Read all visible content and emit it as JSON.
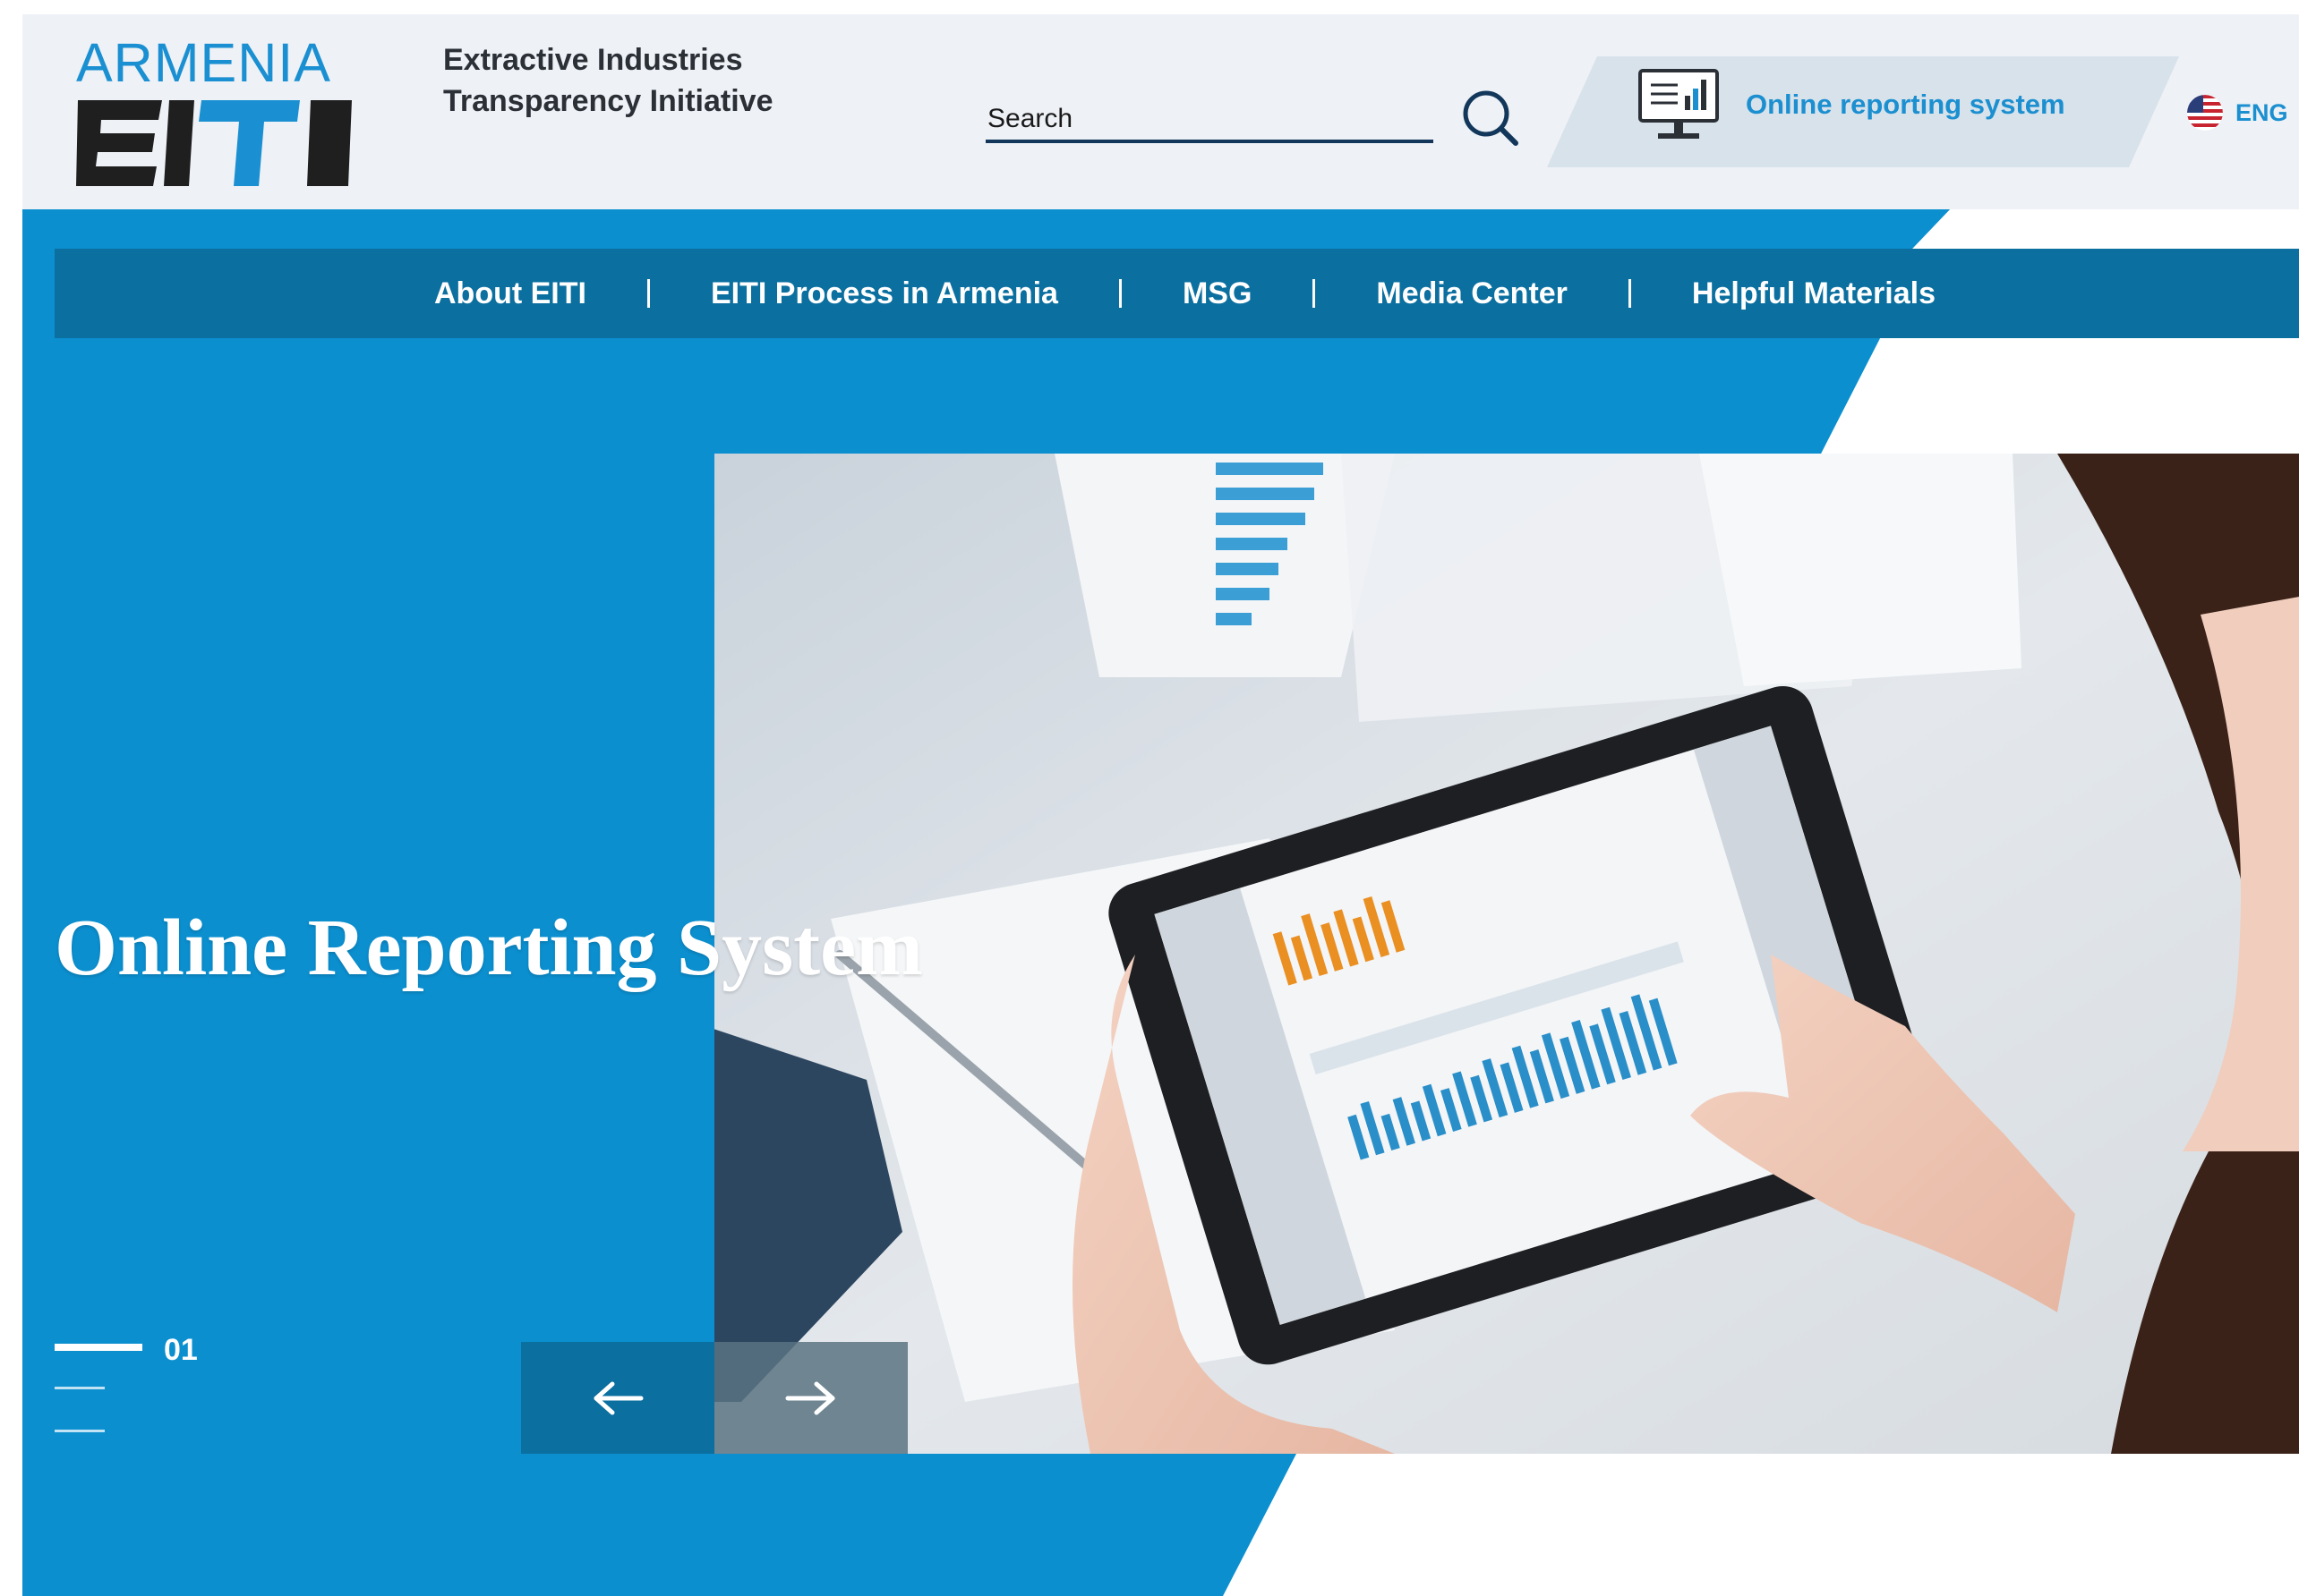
{
  "header": {
    "logo_top": "ARMENIA",
    "logo_bottom": "EITI",
    "tagline_line1": "Extractive Industries",
    "tagline_line2": "Transparency Initiative",
    "search": {
      "placeholder": "Search"
    },
    "online_reporting_label": "Online reporting system",
    "language": "ENG"
  },
  "nav": {
    "items": [
      {
        "label": "About EITI"
      },
      {
        "label": "EITI Process in Armenia"
      },
      {
        "label": "MSG"
      },
      {
        "label": "Media Center"
      },
      {
        "label": "Helpful Materials"
      }
    ]
  },
  "hero": {
    "title": "Online Reporting System",
    "slide_number": "01",
    "slides_total_indicators": 3
  },
  "colors": {
    "brand_blue": "#0b8fcf",
    "nav_blue": "#0b6f9f",
    "header_bg": "#eef1f6",
    "link_blue": "#1b8fd0",
    "logo_dark": "#1f1f1f"
  }
}
